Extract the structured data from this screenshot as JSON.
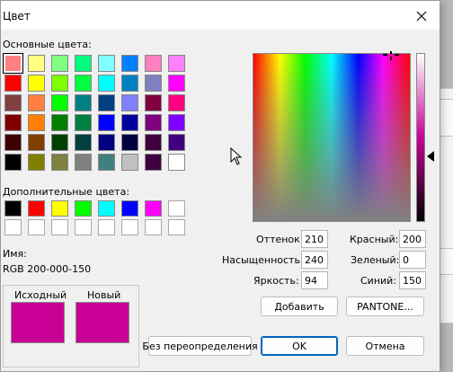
{
  "dialog": {
    "title": "Цвет"
  },
  "basic_colors": {
    "label": "Основные цвета:",
    "swatches": [
      "#ff8080",
      "#ffff80",
      "#80ff80",
      "#00ff80",
      "#80ffff",
      "#0080ff",
      "#ff80c0",
      "#ff80ff",
      "#ff0000",
      "#ffff00",
      "#80ff00",
      "#00ff40",
      "#00ffff",
      "#0080c0",
      "#8080c0",
      "#ff00ff",
      "#804040",
      "#ff8040",
      "#00ff00",
      "#008080",
      "#004080",
      "#8080ff",
      "#800040",
      "#ff0080",
      "#800000",
      "#ff8000",
      "#008000",
      "#008040",
      "#0000ff",
      "#0000a0",
      "#800080",
      "#8000ff",
      "#400000",
      "#804000",
      "#004000",
      "#004040",
      "#000080",
      "#000040",
      "#400040",
      "#400080",
      "#000000",
      "#808000",
      "#808040",
      "#808080",
      "#408080",
      "#c0c0c0",
      "#400040",
      "#ffffff"
    ]
  },
  "custom_colors": {
    "label": "Дополнительные цвета:",
    "swatches": [
      "#000000",
      "#ff0000",
      "#ffff00",
      "#00ff00",
      "#00ffff",
      "#0000ff",
      "#ff00ff",
      "#ffffff",
      "#ffffff",
      "#ffffff",
      "#ffffff",
      "#ffffff",
      "#ffffff",
      "#ffffff",
      "#ffffff",
      "#ffffff"
    ]
  },
  "name": {
    "label": "Имя:",
    "value": "RGB 200-000-150"
  },
  "compare": {
    "original_label": "Исходный",
    "new_label": "Новый",
    "color": "#c80096"
  },
  "hsl": {
    "hue_label": "Оттенок:",
    "hue": "210",
    "sat_label": "Насыщенность:",
    "sat": "240",
    "lum_label": "Яркость:",
    "lum": "94"
  },
  "rgb": {
    "red_label": "Красный:",
    "red": "200",
    "green_label": "Зеленый:",
    "green": "0",
    "blue_label": "Синий:",
    "blue": "150"
  },
  "buttons": {
    "add": "Добавить",
    "pantone": "PANTONE...",
    "no_override": "Без переопределения",
    "ok": "OK",
    "cancel": "Отмена"
  }
}
